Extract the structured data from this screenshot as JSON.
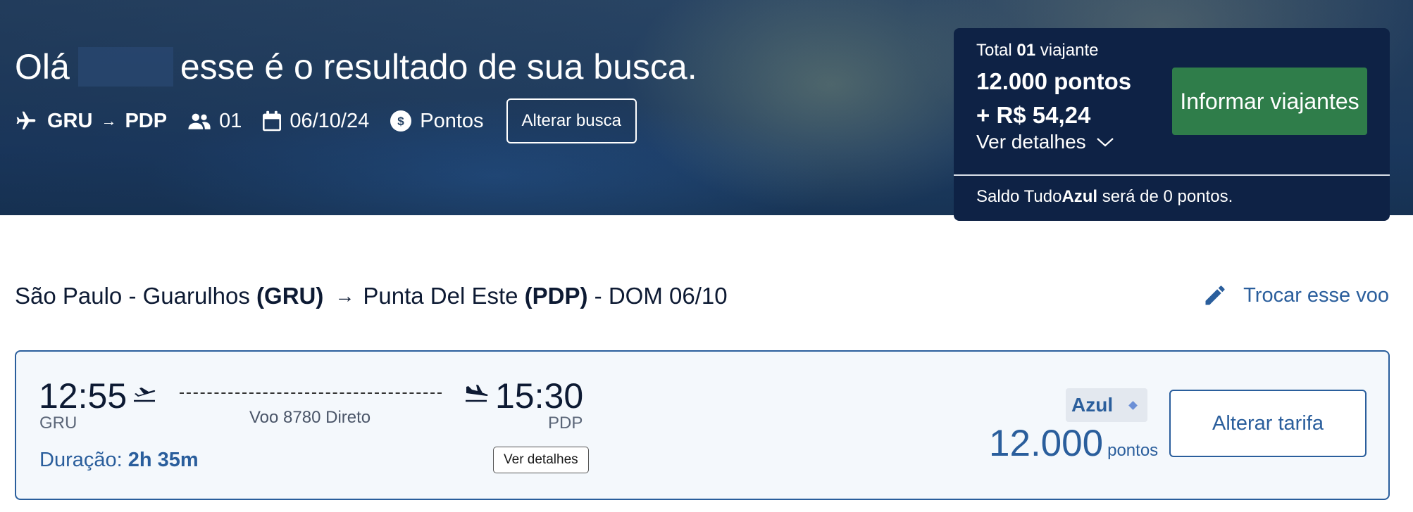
{
  "header": {
    "greeting_hello": "Olá",
    "greeting_rest": "esse é o resultado de sua busca.",
    "search": {
      "origin": "GRU",
      "arrow": "→",
      "destination": "PDP",
      "passengers": "01",
      "date": "06/10/24",
      "currency": "Pontos",
      "alter_button": "Alterar busca"
    }
  },
  "summary": {
    "total_prefix": "Total",
    "total_count": "01",
    "total_suffix": "viajante",
    "points_line": "12.000 pontos",
    "cash_line": "+ R$ 54,24",
    "details_label": "Ver detalhes",
    "cta_label": "Informar viajantes",
    "saldo_prefix": "Saldo Tudo",
    "saldo_brand": "Azul",
    "saldo_suffix": "será de 0 pontos."
  },
  "route": {
    "origin_city": "São Paulo - Guarulhos",
    "origin_code": "(GRU)",
    "arrow": "→",
    "dest_city": "Punta Del Este",
    "dest_code": "(PDP)",
    "date_label": "- DOM 06/10",
    "change_flight": "Trocar esse voo"
  },
  "flight": {
    "departure_time": "12:55",
    "departure_code": "GRU",
    "arrival_time": "15:30",
    "arrival_code": "PDP",
    "flight_info": "Voo 8780 Direto",
    "duration_label": "Duração:",
    "duration_value": "2h 35m",
    "details_button": "Ver detalhes",
    "fare_badge": "Azul",
    "price_value": "12.000",
    "price_unit": "pontos",
    "change_fare_button": "Alterar tarifa"
  },
  "colors": {
    "navy": "#0e2245",
    "accent_blue": "#2a5e9c",
    "cta_green": "#2f7d4a"
  },
  "icons": [
    "plane-icon",
    "passengers-icon",
    "calendar-icon",
    "dollar-coin-icon",
    "chevron-down-icon",
    "pencil-icon",
    "takeoff-icon",
    "landing-icon"
  ]
}
